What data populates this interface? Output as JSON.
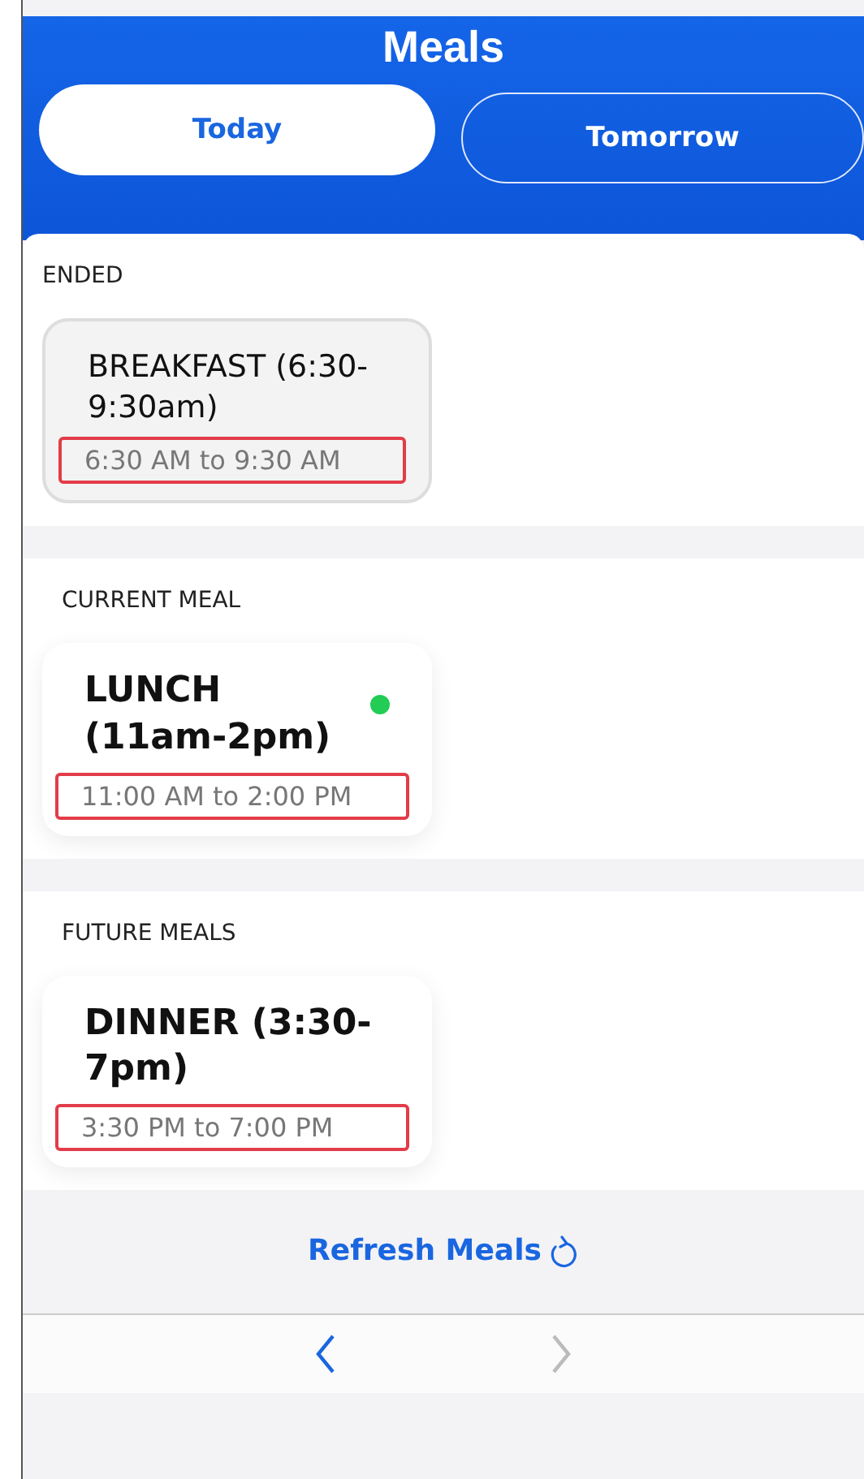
{
  "header": {
    "title": "Meals"
  },
  "tabs": [
    {
      "label": "Today",
      "selected": true
    },
    {
      "label": "Tomorrow",
      "selected": false
    }
  ],
  "sections": [
    {
      "heading": "ENDED",
      "meals": [
        {
          "name": "BREAKFAST (6:30-9:30am)",
          "time": "6:30 AM to 9:30 AM",
          "ended": true,
          "current": false,
          "highlighted": true
        }
      ]
    },
    {
      "heading": "CURRENT MEAL",
      "meals": [
        {
          "name": "LUNCH (11am-2pm)",
          "time": "11:00 AM to 2:00 PM",
          "ended": false,
          "current": true,
          "highlighted": true
        }
      ]
    },
    {
      "heading": "FUTURE MEALS",
      "meals": [
        {
          "name": "DINNER (3:30-7pm)",
          "time": "3:30 PM to 7:00 PM",
          "ended": false,
          "current": false,
          "highlighted": true
        }
      ]
    }
  ],
  "refresh": {
    "label": "Refresh Meals"
  },
  "nav": [
    {
      "kind": "back",
      "disabled": false
    },
    {
      "kind": "forward",
      "disabled": true
    }
  ]
}
